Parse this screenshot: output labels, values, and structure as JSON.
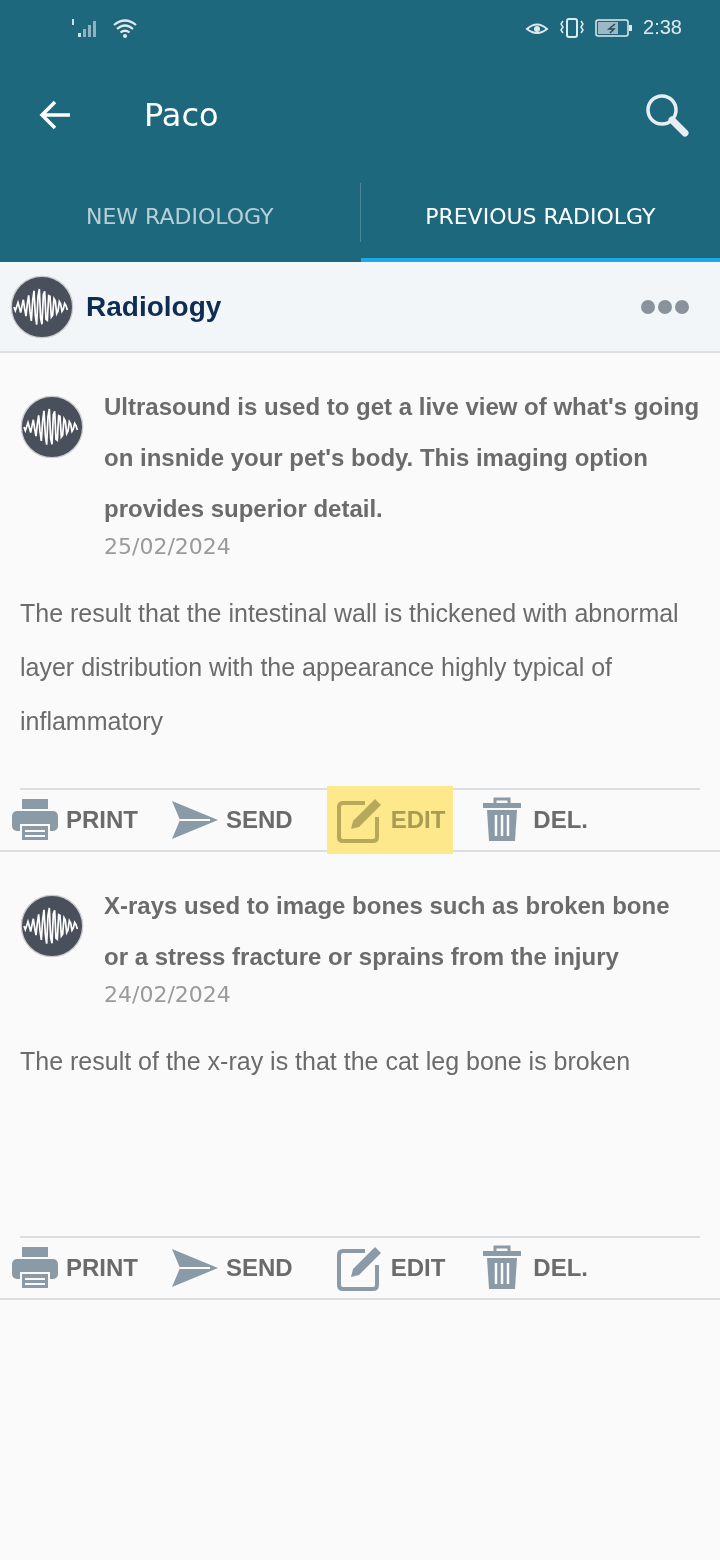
{
  "status_bar": {
    "time": "2:38"
  },
  "app_bar": {
    "title": "Paco"
  },
  "tabs": [
    {
      "label": "NEW RADIOLOGY",
      "selected": false
    },
    {
      "label": "PREVIOUS RADIOLGY",
      "selected": true
    }
  ],
  "section": {
    "title": "Radiology"
  },
  "records": [
    {
      "title": "Ultrasound is used to get a live view of what's going on insnide your pet's body. This imaging option provides superior detail.",
      "date": "25/02/2024",
      "result": "The result that the intestinal wall is thickened with abnormal layer distribution with the appearance highly typical of inflammatory",
      "actions": [
        {
          "kind": "print",
          "label": "PRINT",
          "highlighted": false
        },
        {
          "kind": "send",
          "label": "SEND",
          "highlighted": false
        },
        {
          "kind": "edit",
          "label": "EDIT",
          "highlighted": true
        },
        {
          "kind": "delete",
          "label": "DEL.",
          "highlighted": false
        }
      ]
    },
    {
      "title": "X-rays used to image bones such as broken bone or a stress fracture or sprains from the injury",
      "date": "24/02/2024",
      "result": "The result of the x-ray is that the cat leg bone is broken",
      "actions": [
        {
          "kind": "print",
          "label": "PRINT",
          "highlighted": false
        },
        {
          "kind": "send",
          "label": "SEND",
          "highlighted": false
        },
        {
          "kind": "edit",
          "label": "EDIT",
          "highlighted": false
        },
        {
          "kind": "delete",
          "label": "DEL.",
          "highlighted": false
        }
      ]
    }
  ]
}
